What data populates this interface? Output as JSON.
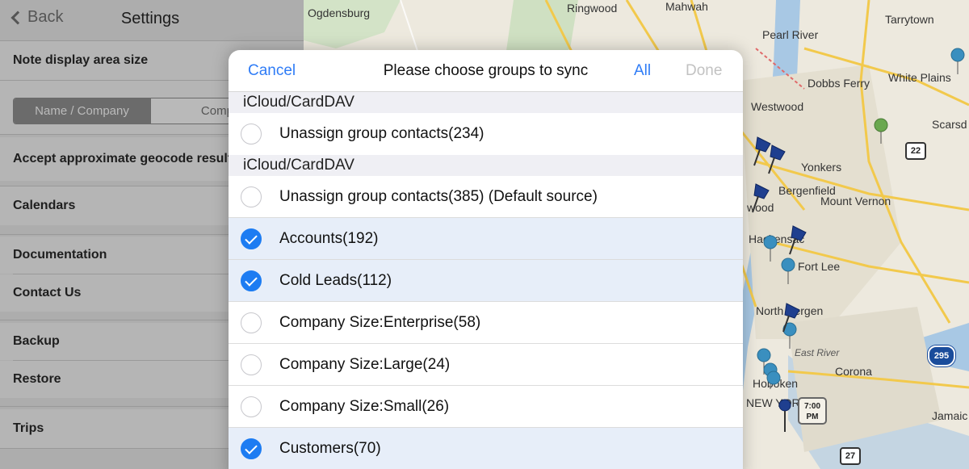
{
  "settings": {
    "back_label": "Back",
    "title": "Settings",
    "note_display": "Note display area size",
    "segment": {
      "selected": "Name / Company",
      "other": "Company"
    },
    "geocode": "Accept approximate geocode results",
    "calendars": "Calendars",
    "documentation": "Documentation",
    "contact_us": "Contact Us",
    "backup": "Backup",
    "restore": "Restore",
    "trips": "Trips"
  },
  "map": {
    "labels": {
      "ogdensburg": "Ogdensburg",
      "ringwood": "Ringwood",
      "mahwah": "Mahwah",
      "tarrytown": "Tarrytown",
      "pearl_river": "Pearl River",
      "white_plains": "White Plains",
      "dobbs_ferry": "Dobbs Ferry",
      "westwood": "Westwood",
      "scarsdale": "Scarsd",
      "yonkers": "Yonkers",
      "bergenfield": "Bergenfield",
      "mount_vernon": "Mount Vernon",
      "hackensack": "Hackensac",
      "fort_lee": "Fort Lee",
      "north_bergen": "North Bergen",
      "east_river": "East River",
      "corona": "Corona",
      "hoboken": "Hoboken",
      "new_york": "NEW YORK",
      "jamaica": "Jamaic",
      "wood": "wood"
    },
    "shields": {
      "r22": "22",
      "i295": "295",
      "r27": "27"
    },
    "time_badge": {
      "line1": "7:00",
      "line2": "PM"
    }
  },
  "modal": {
    "cancel": "Cancel",
    "title": "Please choose groups to sync",
    "all": "All",
    "done": "Done",
    "sections": [
      {
        "header": "iCloud/CardDAV",
        "rows": [
          {
            "label": "Unassign group contacts(234)",
            "checked": false
          }
        ]
      },
      {
        "header": "iCloud/CardDAV",
        "rows": [
          {
            "label": "Unassign group contacts(385)  (Default source)",
            "checked": false
          },
          {
            "label": "Accounts(192)",
            "checked": true
          },
          {
            "label": "Cold Leads(112)",
            "checked": true
          },
          {
            "label": "Company Size:Enterprise(58)",
            "checked": false
          },
          {
            "label": "Company Size:Large(24)",
            "checked": false
          },
          {
            "label": "Company Size:Small(26)",
            "checked": false
          },
          {
            "label": "Customers(70)",
            "checked": true
          }
        ]
      }
    ]
  },
  "colors": {
    "accent": "#1d7cf2",
    "selected_row": "#e7eef9",
    "disabled": "#c2c2c2"
  }
}
